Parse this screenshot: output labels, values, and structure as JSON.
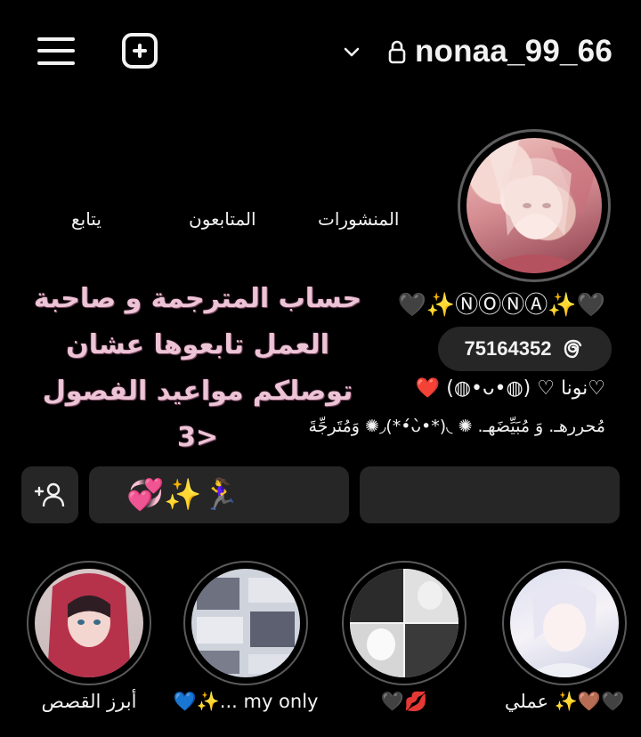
{
  "header": {
    "username": "nonaa_99_66"
  },
  "stats": {
    "posts_label": "المنشورات",
    "followers_label": "المتابعون",
    "following_label": "يتابع"
  },
  "bio": {
    "name_line": "🖤✨ⓃⓄⓃⒶ✨🖤",
    "arabic_title": "حساب المترجمة و صاحبة العمل تابعوها عشان توصلكم مواعيد الفصول <3",
    "threads_count": "75164352",
    "line2": "♡نونا ♡ (◍•ᴗ•◍) ❤️",
    "line3": "مُحررهـ. وَ مُبَيِّضَهـ. ✺ ◟(*•̀ᴗ•́*)◞✺ وَمُتَرجِّةَ"
  },
  "actions": {
    "story_button_label": "💞✨🏃‍♀️"
  },
  "highlights": [
    {
      "label": "عملي ✨🤎🖤"
    },
    {
      "label": "🖤💋"
    },
    {
      "label": "💙✨... my only"
    },
    {
      "label": "أبرز القصص"
    }
  ],
  "colors": {
    "background": "#000000",
    "button_bg": "#262626",
    "title_pink": "#ecc4d6"
  }
}
